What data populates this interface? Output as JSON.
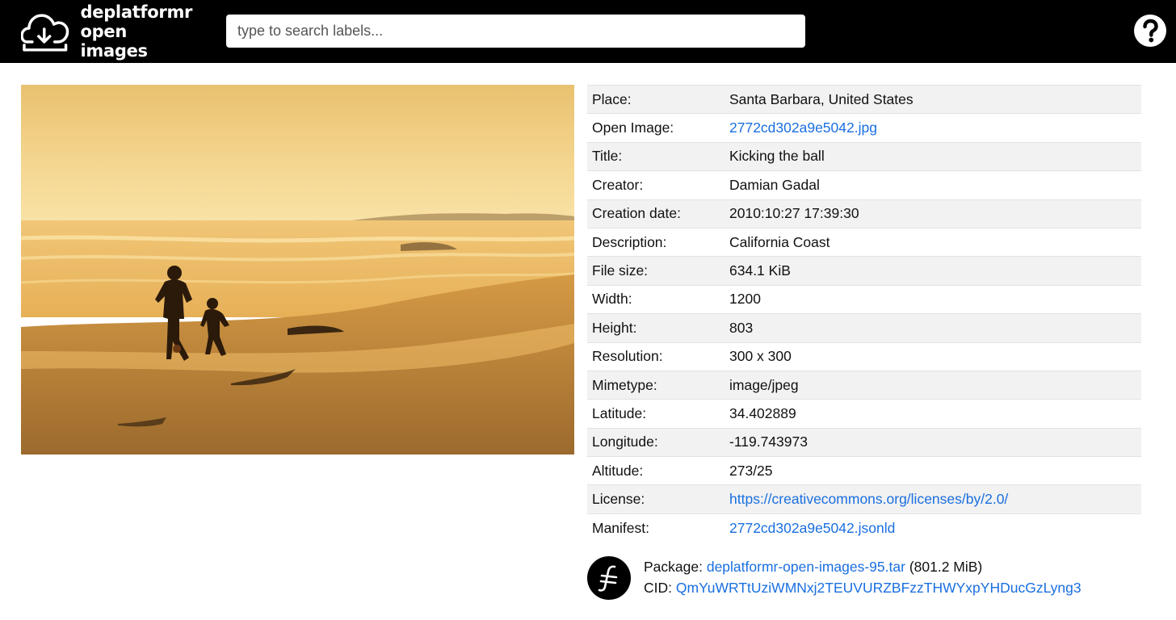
{
  "header": {
    "logo_line1": "deplatformr",
    "logo_line2": "open images",
    "search_placeholder": "type to search labels...",
    "help_icon": "help-question-icon",
    "upload_icon": "cloud-upload-icon"
  },
  "photo": {
    "subject": "beach-photo",
    "palette": {
      "sky": "#f2cc7a",
      "sea": "#e9b45c",
      "sand": "#b07a34"
    }
  },
  "metadata": [
    {
      "key": "Place:",
      "value": "Santa Barbara, United States",
      "link": false
    },
    {
      "key": "Open Image:",
      "value": "2772cd302a9e5042.jpg",
      "link": true
    },
    {
      "key": "Title:",
      "value": "Kicking the ball",
      "link": false
    },
    {
      "key": "Creator:",
      "value": "Damian Gadal",
      "link": false
    },
    {
      "key": "Creation date:",
      "value": "2010:10:27 17:39:30",
      "link": false
    },
    {
      "key": "Description:",
      "value": "California Coast",
      "link": false
    },
    {
      "key": "File size:",
      "value": "634.1 KiB",
      "link": false
    },
    {
      "key": "Width:",
      "value": "1200",
      "link": false
    },
    {
      "key": "Height:",
      "value": "803",
      "link": false
    },
    {
      "key": "Resolution:",
      "value": "300 x 300",
      "link": false
    },
    {
      "key": "Mimetype:",
      "value": "image/jpeg",
      "link": false
    },
    {
      "key": "Latitude:",
      "value": "34.402889",
      "link": false
    },
    {
      "key": "Longitude:",
      "value": "-119.743973",
      "link": false
    },
    {
      "key": "Altitude:",
      "value": "273/25",
      "link": false
    },
    {
      "key": "License:",
      "value": "https://creativecommons.org/licenses/by/2.0/",
      "link": true
    },
    {
      "key": "Manifest:",
      "value": "2772cd302a9e5042.jsonld",
      "link": true
    }
  ],
  "package": {
    "icon": "filecoin-icon",
    "package_label": "Package:",
    "package_name": "deplatformr-open-images-95.tar",
    "package_size": "(801.2 MiB)",
    "cid_label": "CID:",
    "cid_value": "QmYuWRTtUziWMNxj2TEUVURZBFzzTHWYxpYHDucGzLyng3"
  },
  "colors": {
    "header_bg": "#000000",
    "link": "#1a6fe0",
    "row_alt": "#f2f2f2"
  }
}
